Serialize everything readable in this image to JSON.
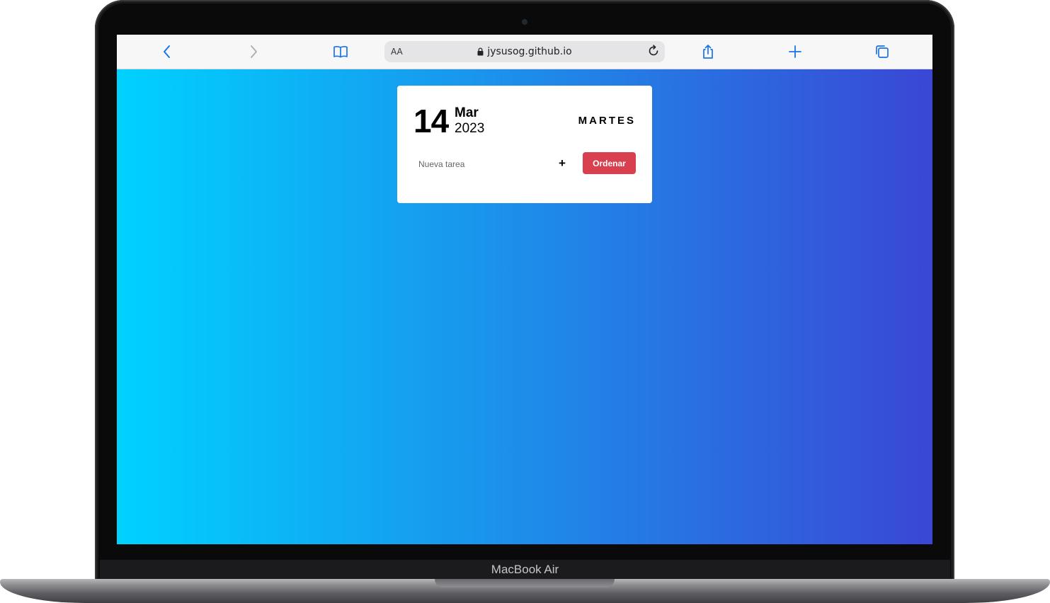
{
  "device": {
    "model_label": "MacBook Air"
  },
  "browser": {
    "text_size_label": "AA",
    "url": "jysusog.github.io",
    "icons": {
      "back": "chevron-left-icon",
      "forward": "chevron-right-icon",
      "bookmarks": "book-icon",
      "secure": "lock-icon",
      "reload": "reload-icon",
      "share": "share-icon",
      "new_tab": "plus-icon",
      "tabs": "tabs-icon"
    },
    "colors": {
      "accent": "#1a73e8",
      "disabled": "#b0b0b0"
    }
  },
  "app": {
    "background": {
      "from": "#00d2ff",
      "to": "#3a47d5"
    },
    "date": {
      "day": "14",
      "month": "Mar",
      "year": "2023",
      "weekday": "MARTES"
    },
    "task_input": {
      "placeholder": "Nueva tarea",
      "value": ""
    },
    "add_button_label": "+",
    "sort_button_label": "Ordenar",
    "colors": {
      "sort_button": "#d9404f"
    }
  }
}
